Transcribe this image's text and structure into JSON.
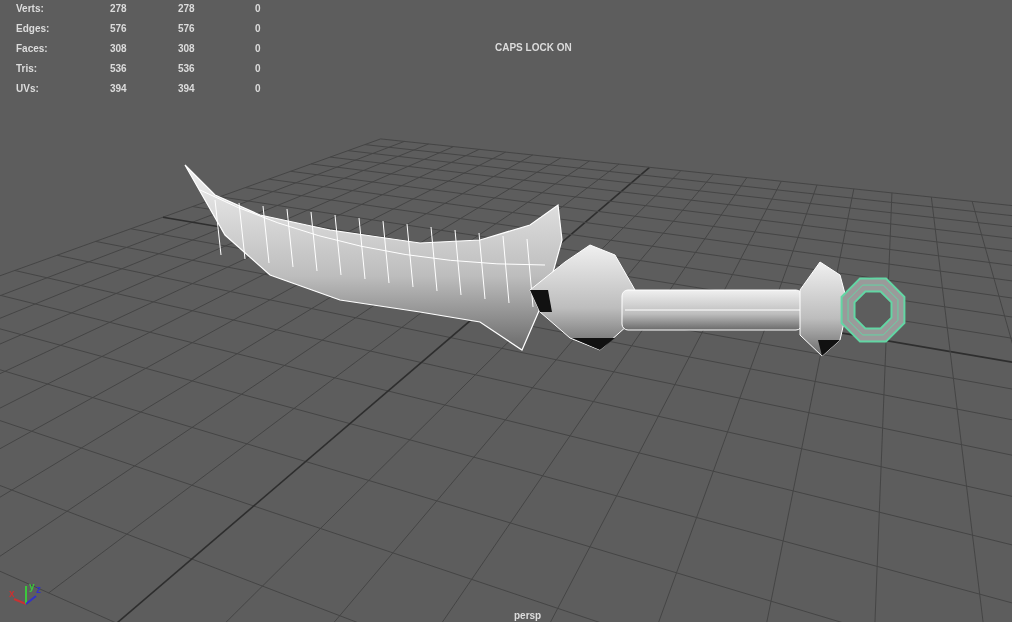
{
  "stats": [
    {
      "label": "Verts:",
      "values": [
        "278",
        "278",
        "0"
      ]
    },
    {
      "label": "Edges:",
      "values": [
        "576",
        "576",
        "0"
      ]
    },
    {
      "label": "Faces:",
      "values": [
        "308",
        "308",
        "0"
      ]
    },
    {
      "label": "Tris:",
      "values": [
        "536",
        "536",
        "0"
      ]
    },
    {
      "label": "UVs:",
      "values": [
        "394",
        "394",
        "0"
      ]
    }
  ],
  "notice": "CAPS LOCK ON",
  "ring": {
    "selected": true
  },
  "axes": [
    {
      "label": "x",
      "color": "#c83232"
    },
    {
      "label": "y",
      "color": "#3cc83c"
    },
    {
      "label": "z",
      "color": "#3232c8"
    }
  ],
  "camera": "persp"
}
